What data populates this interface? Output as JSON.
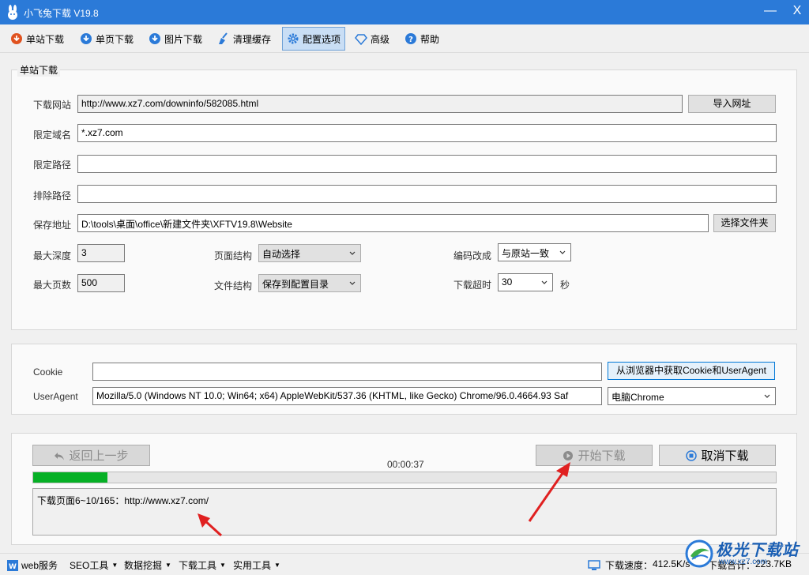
{
  "window": {
    "title": "小飞兔下载 V19.8",
    "minimize": "—",
    "close": "X"
  },
  "toolbar": [
    {
      "label": "单站下载",
      "icon": "download-cloud-icon"
    },
    {
      "label": "单页下载",
      "icon": "download-cloud-icon"
    },
    {
      "label": "图片下载",
      "icon": "download-cloud-icon"
    },
    {
      "label": "清理缓存",
      "icon": "broom-icon"
    },
    {
      "label": "配置选项",
      "icon": "gear-icon",
      "active": true
    },
    {
      "label": "高级",
      "icon": "diamond-icon"
    },
    {
      "label": "帮助",
      "icon": "help-icon"
    }
  ],
  "site_group": {
    "title": "单站下载",
    "url_label": "下载网站",
    "url_value": "http://www.xz7.com/downinfo/582085.html",
    "import_button": "导入网址",
    "domain_label": "限定域名",
    "domain_value": "*.xz7.com",
    "path_label": "限定路径",
    "path_value": "",
    "exclude_label": "排除路径",
    "exclude_value": "",
    "save_label": "保存地址",
    "save_value": "D:\\tools\\桌面\\office\\新建文件夹\\XFTV19.8\\Website",
    "choose_folder_button": "选择文件夹",
    "max_depth_label": "最大深度",
    "max_depth_value": "3",
    "max_pages_label": "最大页数",
    "max_pages_value": "500",
    "page_structure_label": "页面结构",
    "page_structure_value": "自动选择",
    "file_structure_label": "文件结构",
    "file_structure_value": "保存到配置目录",
    "encoding_label": "编码改成",
    "encoding_value": "与原站一致",
    "timeout_label": "下载超时",
    "timeout_value": "30",
    "timeout_unit": "秒"
  },
  "agent_group": {
    "cookie_label": "Cookie",
    "cookie_value": "",
    "get_cookie_button": "从浏览器中获取Cookie和UserAgent",
    "ua_label": "UserAgent",
    "ua_value": "Mozilla/5.0 (Windows NT 10.0; Win64; x64) AppleWebKit/537.36 (KHTML, like Gecko) Chrome/96.0.4664.93 Saf",
    "ua_preset": "电脑Chrome"
  },
  "control": {
    "back_button": "返回上一步",
    "timer": "00:00:37",
    "start_button": "开始下载",
    "cancel_button": "取消下载",
    "progress": 0.1,
    "log_text": "下载页面6~10/165：http://www.xz7.com/"
  },
  "statusbar": {
    "menus": [
      {
        "label": "web服务",
        "caret": false
      },
      {
        "label": "SEO工具",
        "caret": true
      },
      {
        "label": "数据挖掘",
        "caret": true
      },
      {
        "label": "下载工具",
        "caret": true
      },
      {
        "label": "实用工具",
        "caret": true
      }
    ],
    "speed_label": "下载速度：",
    "speed_value": "412.5K/s",
    "total_label": "下载合计：",
    "total_value": "223.7KB"
  },
  "watermark": {
    "text": "极光下载站",
    "url": "www.xz7.com"
  },
  "colors": {
    "titlebar": "#2b7ad8",
    "progress": "#06b025",
    "arrow": "#e02020"
  }
}
